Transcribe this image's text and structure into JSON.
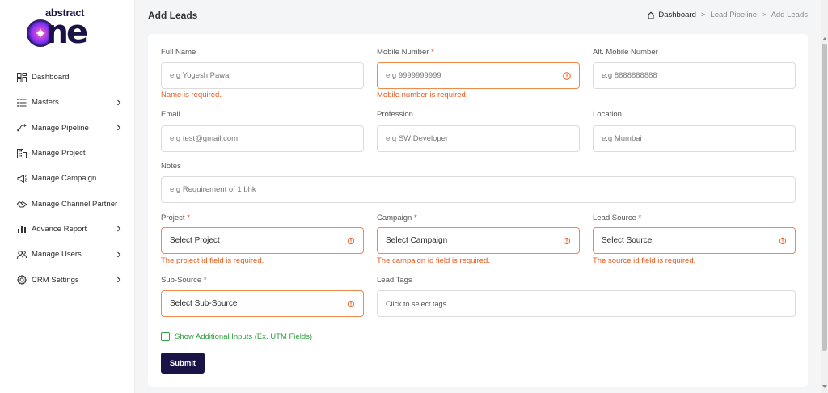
{
  "brand": {
    "top": "abstract",
    "bottom": "one"
  },
  "sidebar": {
    "items": [
      {
        "label": "Dashboard",
        "icon": "dashboard-icon",
        "has_chevron": false
      },
      {
        "label": "Masters",
        "icon": "list-icon",
        "has_chevron": true
      },
      {
        "label": "Manage Pipeline",
        "icon": "pipeline-icon",
        "has_chevron": true
      },
      {
        "label": "Manage Project",
        "icon": "building-icon",
        "has_chevron": false
      },
      {
        "label": "Manage Campaign",
        "icon": "megaphone-icon",
        "has_chevron": false
      },
      {
        "label": "Manage Channel Partner",
        "icon": "partner-icon",
        "has_chevron": false
      },
      {
        "label": "Advance Report",
        "icon": "bar-chart-icon",
        "has_chevron": true
      },
      {
        "label": "Manage Users",
        "icon": "users-icon",
        "has_chevron": true
      },
      {
        "label": "CRM Settings",
        "icon": "gear-icon",
        "has_chevron": true
      }
    ]
  },
  "header": {
    "title": "Add Leads",
    "breadcrumb": [
      "Dashboard",
      "Lead Pipeline",
      "Add Leads"
    ],
    "separator": ">"
  },
  "form": {
    "full_name": {
      "label": "Full Name",
      "placeholder": "e.g Yogesh Pawar",
      "error": "Name is required."
    },
    "mobile": {
      "label": "Mobile Number",
      "required": "*",
      "placeholder": "e.g 9999999999",
      "error": "Mobile number is required."
    },
    "alt_mobile": {
      "label": "Alt. Mobile Number",
      "placeholder": "e.g 8888888888"
    },
    "email": {
      "label": "Email",
      "placeholder": "e.g test@gmail.com"
    },
    "profession": {
      "label": "Profession",
      "placeholder": "e.g SW Developer"
    },
    "location": {
      "label": "Location",
      "placeholder": "e.g Mumbai"
    },
    "notes": {
      "label": "Notes",
      "placeholder": "e.g Requirement of 1 bhk"
    },
    "project": {
      "label": "Project",
      "required": "*",
      "value": "Select Project",
      "error": "The project id field is required."
    },
    "campaign": {
      "label": "Campaign",
      "required": "*",
      "value": "Select Campaign",
      "error": "The campaign id field is required."
    },
    "lead_source": {
      "label": "Lead Source",
      "required": "*",
      "value": "Select Source",
      "error": "The source id field is required."
    },
    "sub_source": {
      "label": "Sub-Source",
      "required": "*",
      "value": "Select Sub-Source"
    },
    "lead_tags": {
      "label": "Lead Tags",
      "placeholder": "Click to select tags"
    },
    "additional_inputs": {
      "label": "Show Additional Inputs (Ex. UTM Fields)",
      "checked": false
    },
    "submit_label": "Submit"
  },
  "colors": {
    "brand": "#1a1446",
    "error": "#e65a1e",
    "error_border": "#f08a4b",
    "checkbox": "#2e9e3e"
  }
}
